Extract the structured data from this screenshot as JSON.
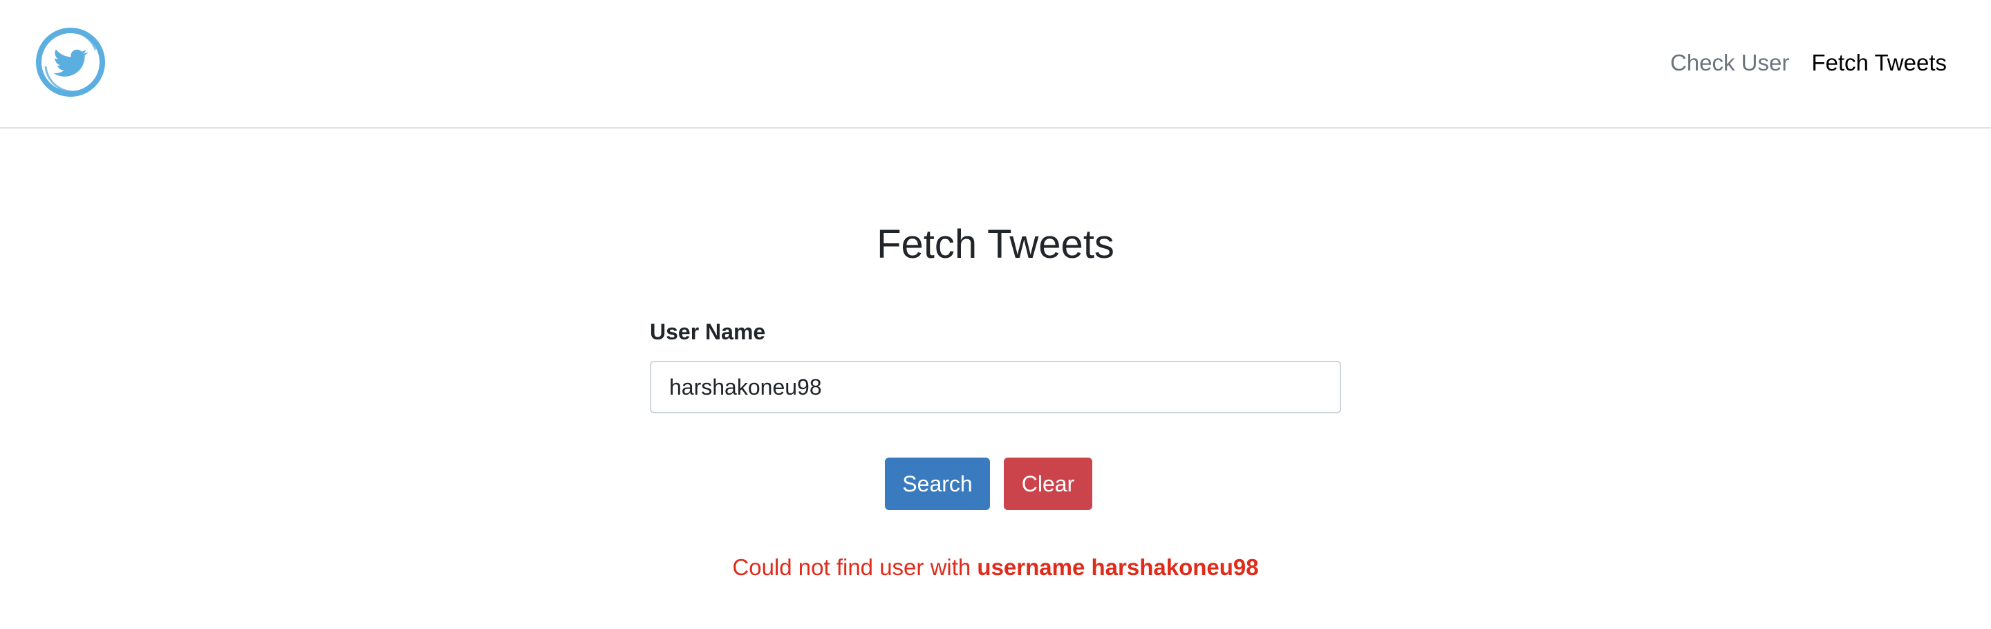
{
  "nav": {
    "logo_icon": "twitter-bird-icon",
    "links": [
      {
        "label": "Check User",
        "active": false
      },
      {
        "label": "Fetch Tweets",
        "active": true
      }
    ]
  },
  "main": {
    "title": "Fetch Tweets",
    "field_label": "User Name",
    "input_value": "harshakoneu98",
    "search_label": "Search",
    "clear_label": "Clear",
    "error_prefix": "Could not find user with ",
    "error_bold": "username harshakoneu98"
  },
  "colors": {
    "accent": "#5aaee0",
    "search_button": "#3a7bbf",
    "clear_button": "#cc444b",
    "error_text": "#e02a1a"
  }
}
